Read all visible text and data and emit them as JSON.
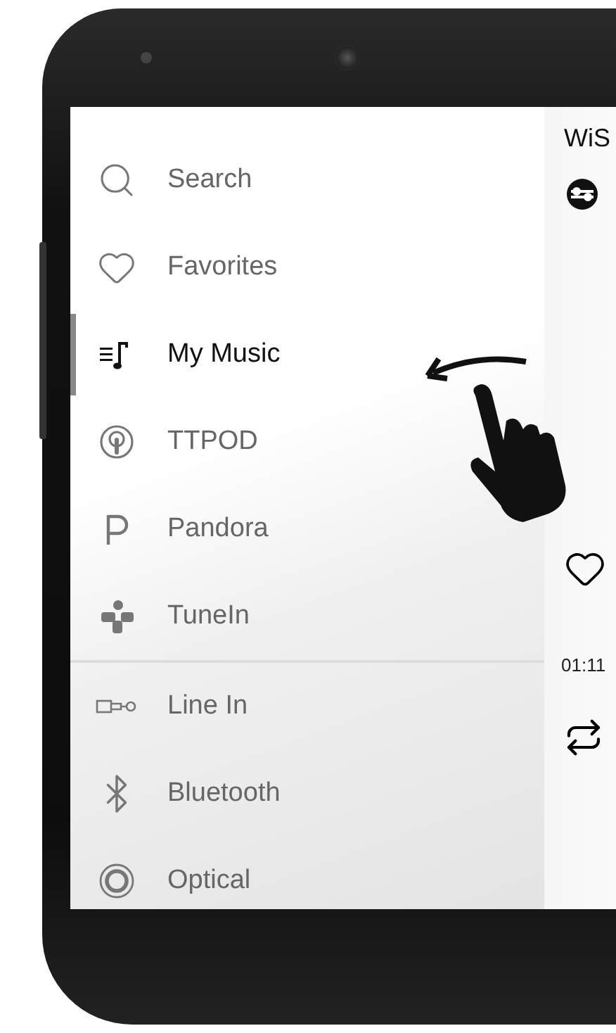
{
  "drawer": {
    "sections": [
      {
        "items": [
          {
            "label": "Search",
            "selected": false
          },
          {
            "label": "Favorites",
            "selected": false
          },
          {
            "label": "My Music",
            "selected": true
          },
          {
            "label": "TTPOD",
            "selected": false
          },
          {
            "label": "Pandora",
            "selected": false
          },
          {
            "label": "TuneIn",
            "selected": false
          }
        ]
      },
      {
        "items": [
          {
            "label": "Line In",
            "selected": false
          },
          {
            "label": "Bluetooth",
            "selected": false
          },
          {
            "label": "Optical",
            "selected": false
          }
        ]
      }
    ]
  },
  "player": {
    "title": "WiS",
    "favorite": false,
    "time": "01:11"
  }
}
